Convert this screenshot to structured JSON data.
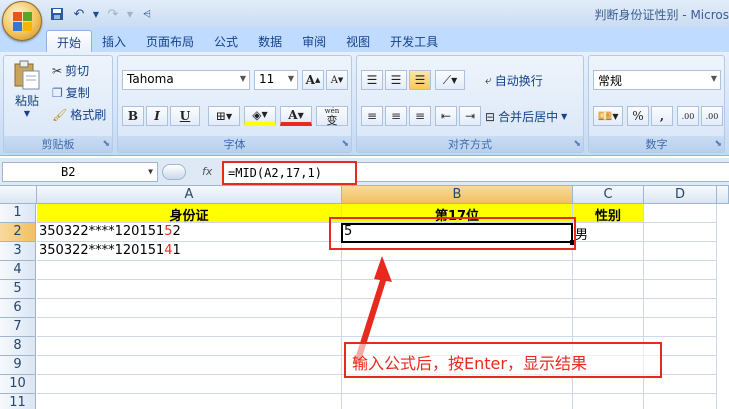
{
  "window": {
    "title": "判断身份证性别 - Micros"
  },
  "tabs": [
    "开始",
    "插入",
    "页面布局",
    "公式",
    "数据",
    "审阅",
    "视图",
    "开发工具"
  ],
  "ribbon": {
    "clipboard": {
      "paste": "粘贴",
      "cut": "剪切",
      "copy": "复制",
      "format_painter": "格式刷",
      "label": "剪贴板"
    },
    "font": {
      "name": "Tahoma",
      "size": "11",
      "grow": "A",
      "shrink": "A",
      "bold": "B",
      "italic": "I",
      "underline": "U",
      "phonetic": "wén",
      "phonetic_char": "变",
      "label": "字体"
    },
    "alignment": {
      "wrap": "自动换行",
      "merge": "合并后居中",
      "label": "对齐方式"
    },
    "number": {
      "format": "常规",
      "percent": "%",
      "comma": ",",
      "inc_decimal": ".00",
      "dec_decimal": ".00",
      "label": "数字"
    }
  },
  "formula_bar": {
    "name_box": "B2",
    "fx": "fx",
    "formula": "=MID(A2,17,1)"
  },
  "columns": [
    "A",
    "B",
    "C",
    "D"
  ],
  "rows": [
    "1",
    "2",
    "3",
    "4",
    "5",
    "6",
    "7",
    "8",
    "9",
    "10",
    "11"
  ],
  "cells": {
    "A1": "身份证",
    "B1": "第17位",
    "C1": "性别",
    "A2_prefix": "350322****120151",
    "A2_red": "5",
    "A2_suffix": "2",
    "B2": "5",
    "C2": "男",
    "A3_prefix": "350322****120151",
    "A3_red": "4",
    "A3_suffix": "1"
  },
  "annotation": "输入公式后，按Enter，显示结果",
  "colors": {
    "highlight": "#e8291e",
    "header_fill": "#ffff00"
  }
}
